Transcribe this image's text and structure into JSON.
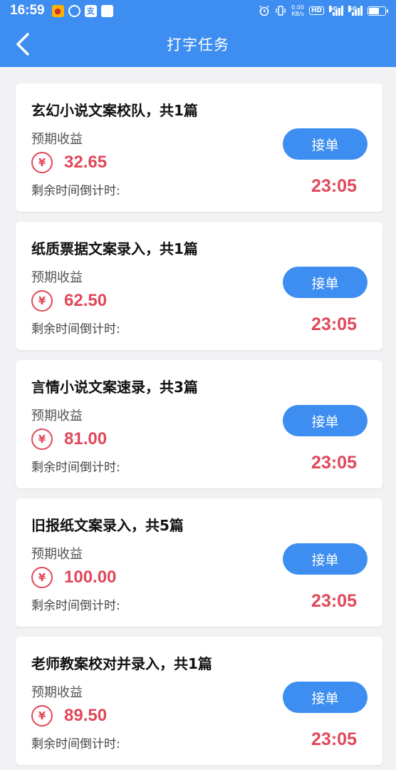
{
  "status": {
    "time": "16:59",
    "net_speed_top": "0.00",
    "net_speed_bottom": "KB/s",
    "hd": "HD",
    "sim1": "5G",
    "sim2": "5G",
    "app_alipay": "支"
  },
  "header": {
    "title": "打字任务"
  },
  "colors": {
    "accent": "#3d8ef0",
    "amount": "#e0485a"
  },
  "labels": {
    "earn": "预期收益",
    "remain": "剩余时间倒计时:",
    "accept": "接单",
    "currency": "¥"
  },
  "tasks": [
    {
      "title": "玄幻小说文案校队，共1篇",
      "amount": "32.65",
      "countdown": "23:05"
    },
    {
      "title": "纸质票据文案录入，共1篇",
      "amount": "62.50",
      "countdown": "23:05"
    },
    {
      "title": "言情小说文案速录，共3篇",
      "amount": "81.00",
      "countdown": "23:05"
    },
    {
      "title": "旧报纸文案录入，共5篇",
      "amount": "100.00",
      "countdown": "23:05"
    },
    {
      "title": "老师教案校对并录入，共1篇",
      "amount": "89.50",
      "countdown": "23:05"
    }
  ]
}
